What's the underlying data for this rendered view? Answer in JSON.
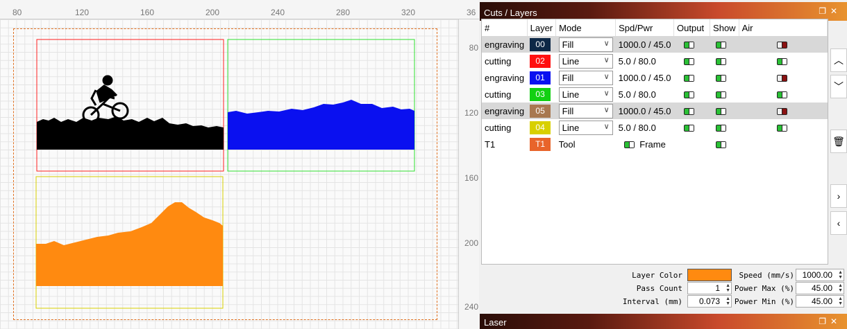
{
  "ruler": {
    "top": [
      "80",
      "120",
      "160",
      "200",
      "240",
      "280",
      "320",
      "36"
    ],
    "right": [
      "80",
      "120",
      "160",
      "200",
      "240"
    ]
  },
  "cuts": {
    "title": "Cuts / Layers",
    "headers": [
      "#",
      "Layer",
      "Mode",
      "Spd/Pwr",
      "Output",
      "Show",
      "Air"
    ],
    "rows": [
      {
        "name": "engraving",
        "layer": "00",
        "color": "#0d2846",
        "mode": "Fill",
        "spdpwr": "1000.0 / 45.0",
        "output": true,
        "show": true,
        "air": false,
        "selected": true
      },
      {
        "name": "cutting",
        "layer": "02",
        "color": "#ff1010",
        "mode": "Line",
        "spdpwr": "5.0 / 80.0",
        "output": true,
        "show": true,
        "air": true,
        "selected": false
      },
      {
        "name": "engraving",
        "layer": "01",
        "color": "#0a10f0",
        "mode": "Fill",
        "spdpwr": "1000.0 / 45.0",
        "output": true,
        "show": true,
        "air": false,
        "selected": false
      },
      {
        "name": "cutting",
        "layer": "03",
        "color": "#12d012",
        "mode": "Line",
        "spdpwr": "5.0 / 80.0",
        "output": true,
        "show": true,
        "air": true,
        "selected": false
      },
      {
        "name": "engraving",
        "layer": "05",
        "color": "#a87850",
        "mode": "Fill",
        "spdpwr": "1000.0 / 45.0",
        "output": true,
        "show": true,
        "air": false,
        "selected": true
      },
      {
        "name": "cutting",
        "layer": "04",
        "color": "#d8d000",
        "mode": "Line",
        "spdpwr": "5.0 / 80.0",
        "output": true,
        "show": true,
        "air": true,
        "selected": false
      }
    ],
    "tool": {
      "name": "T1",
      "layer": "T1",
      "color": "#e8642a",
      "mode": "Tool",
      "frame": "Frame"
    }
  },
  "props": {
    "layer_color_label": "Layer Color",
    "layer_color": "#ff8a10",
    "speed_label": "Speed (mm/s)",
    "speed": "1000.00",
    "pass_count_label": "Pass Count",
    "pass_count": "1",
    "power_max_label": "Power Max (%)",
    "power_max": "45.00",
    "interval_label": "Interval (mm)",
    "interval": "0.073",
    "power_min_label": "Power Min (%)",
    "power_min": "45.00"
  },
  "laser": {
    "title": "Laser"
  },
  "icons": {
    "up": "chevron-up-icon",
    "down": "chevron-down-icon",
    "trash": "trash-icon",
    "right": "chevron-right-icon",
    "left": "chevron-left-icon"
  }
}
